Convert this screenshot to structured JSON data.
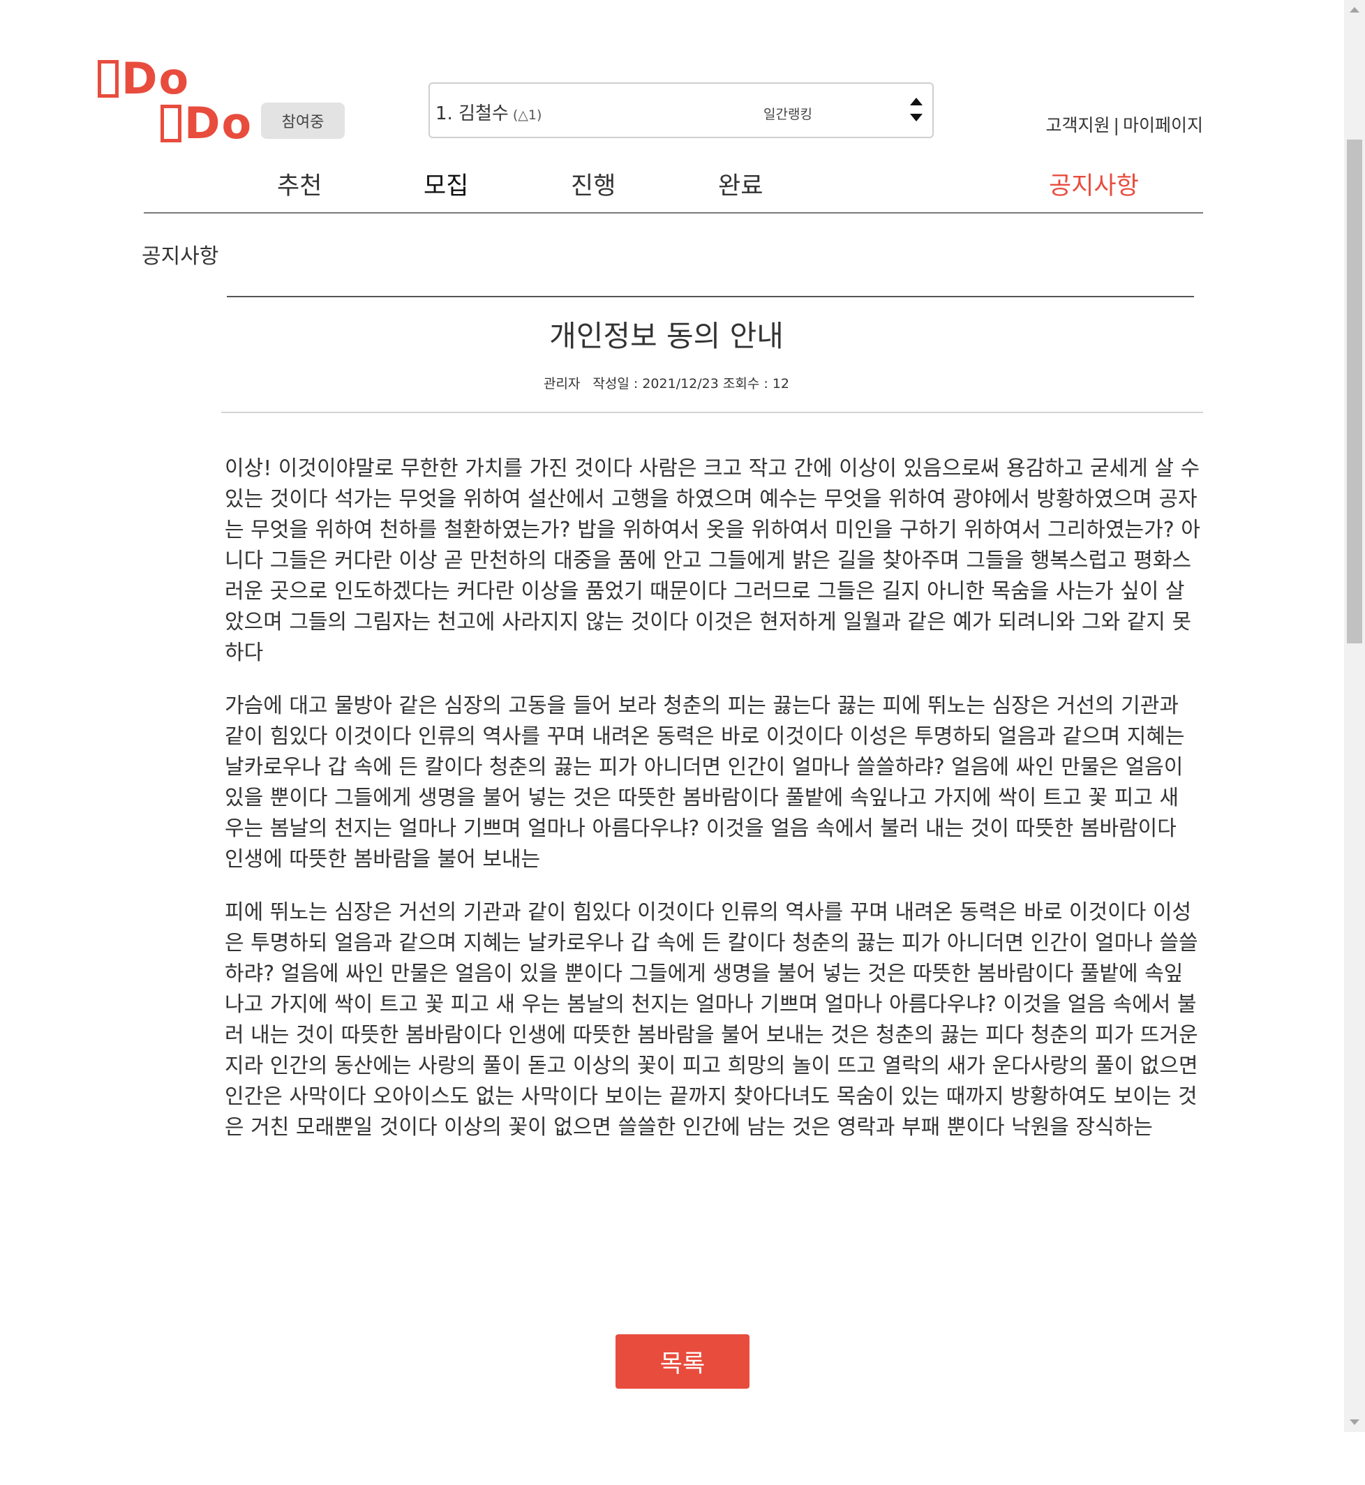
{
  "logo": {
    "line1": "Do",
    "line2": "Do"
  },
  "header": {
    "badge": "참여중",
    "ranking": {
      "name": "1. 김철수",
      "change": "(△1)",
      "type": "일간랭킹"
    },
    "links": {
      "support": "고객지원",
      "separator": "|",
      "mypage": "마이페이지"
    }
  },
  "nav": {
    "items": [
      {
        "label": "추천"
      },
      {
        "label": "모집"
      },
      {
        "label": "진행"
      },
      {
        "label": "완료"
      },
      {
        "label": "공지사항"
      }
    ]
  },
  "section": {
    "title": "공지사항"
  },
  "post": {
    "title": "개인정보 동의 안내",
    "author": "관리자",
    "date": "작성일 : 2021/12/23",
    "views": "조회수 : 12",
    "paragraphs": [
      "이상! 이것이야말로 무한한 가치를 가진 것이다 사람은 크고 작고 간에 이상이 있음으로써 용감하고 굳세게 살 수 있는 것이다 석가는 무엇을 위하여 설산에서 고행을 하였으며 예수는 무엇을 위하여 광야에서 방황하였으며 공자는 무엇을 위하여 천하를 철환하였는가? 밥을 위하여서 옷을 위하여서 미인을 구하기 위하여서 그리하였는가? 아니다 그들은 커다란 이상 곧 만천하의 대중을 품에 안고 그들에게 밝은 길을 찾아주며 그들을 행복스럽고 평화스러운 곳으로 인도하겠다는 커다란 이상을 품었기 때문이다 그러므로 그들은 길지 아니한 목숨을 사는가 싶이 살았으며 그들의 그림자는 천고에 사라지지 않는 것이다 이것은 현저하게 일월과 같은 예가 되려니와 그와 같지 못하다",
      "가슴에 대고 물방아 같은 심장의 고동을 들어 보라 청춘의 피는 끓는다 끓는 피에 뛰노는 심장은 거선의 기관과 같이 힘있다 이것이다 인류의 역사를 꾸며 내려온 동력은 바로 이것이다 이성은 투명하되 얼음과 같으며 지혜는 날카로우나 갑 속에 든 칼이다 청춘의 끓는 피가 아니더면 인간이 얼마나 쓸쓸하랴? 얼음에 싸인 만물은 얼음이 있을 뿐이다 그들에게 생명을 불어 넣는 것은 따뜻한 봄바람이다 풀밭에 속잎나고 가지에 싹이 트고 꽃 피고 새 우는 봄날의 천지는 얼마나 기쁘며 얼마나 아름다우냐? 이것을 얼음 속에서 불러 내는 것이 따뜻한 봄바람이다 인생에 따뜻한 봄바람을 불어 보내는",
      "피에 뛰노는 심장은 거선의 기관과 같이 힘있다 이것이다 인류의 역사를 꾸며 내려온 동력은 바로 이것이다 이성은 투명하되 얼음과 같으며 지혜는 날카로우나 갑 속에 든 칼이다 청춘의 끓는 피가 아니더면 인간이 얼마나 쓸쓸하랴? 얼음에 싸인 만물은 얼음이 있을 뿐이다 그들에게 생명을 불어 넣는 것은 따뜻한 봄바람이다 풀밭에 속잎나고 가지에 싹이 트고 꽃 피고 새 우는 봄날의 천지는 얼마나 기쁘며 얼마나 아름다우냐? 이것을 얼음 속에서 불러 내는 것이 따뜻한 봄바람이다 인생에 따뜻한 봄바람을 불어 보내는 것은 청춘의 끓는 피다 청춘의 피가 뜨거운지라 인간의 동산에는 사랑의 풀이 돋고 이상의 꽃이 피고 희망의 놀이 뜨고 열락의 새가 운다사랑의 풀이 없으면 인간은 사막이다 오아이스도 없는 사막이다 보이는 끝까지 찾아다녀도 목숨이 있는 때까지 방황하여도 보이는 것은 거친 모래뿐일 것이다 이상의 꽃이 없으면 쓸쓸한 인간에 남는 것은 영락과 부패 뿐이다 낙원을 장식하는"
    ]
  },
  "actions": {
    "list_button": "목록"
  },
  "colors": {
    "accent": "#e84c3d",
    "text": "#333333",
    "badge_bg": "#e3e3e3"
  }
}
